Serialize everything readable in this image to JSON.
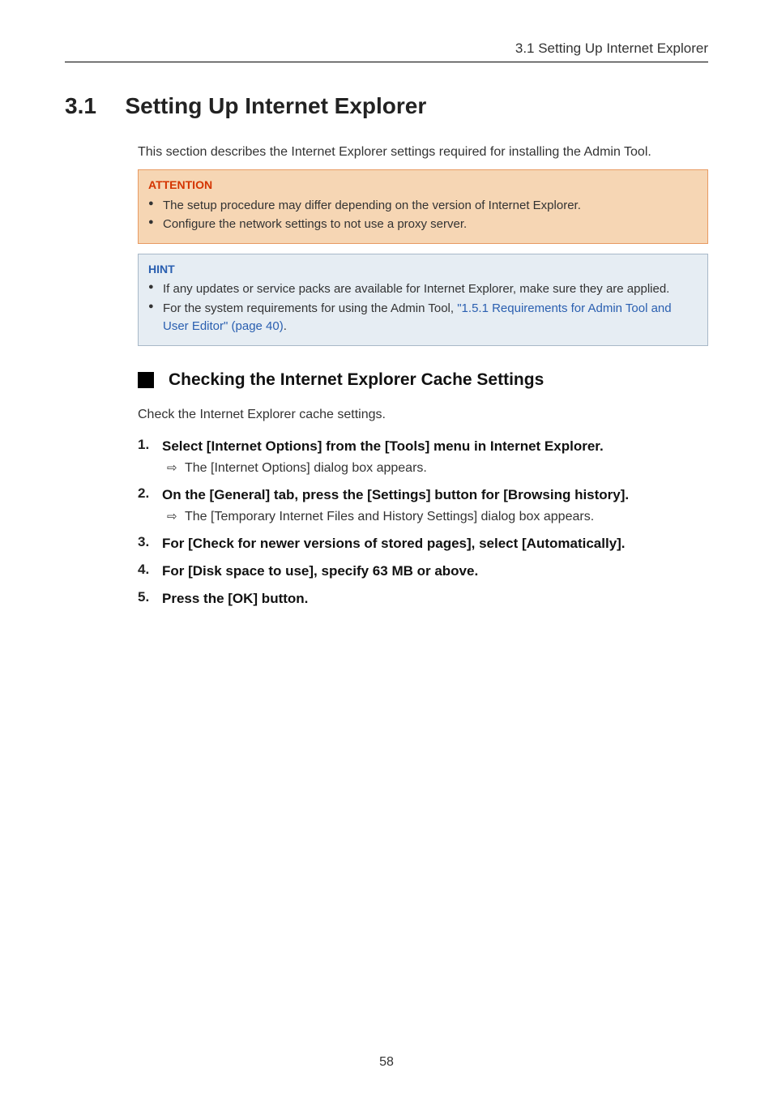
{
  "header": {
    "breadcrumb": "3.1 Setting Up Internet Explorer"
  },
  "section": {
    "number": "3.1",
    "title": "Setting Up Internet Explorer"
  },
  "intro": "This section describes the Internet Explorer settings required for installing the Admin Tool.",
  "attention": {
    "title": "ATTENTION",
    "items": [
      "The setup procedure may differ depending on the version of Internet Explorer.",
      "Configure the network settings to not use a proxy server."
    ]
  },
  "hint": {
    "title": "HINT",
    "item1": "If any updates or service packs are available for Internet Explorer, make sure they are applied.",
    "item2_prefix": "For the system requirements for using the Admin Tool, ",
    "item2_link": "\"1.5.1 Requirements for Admin Tool and User Editor\" (page 40)",
    "item2_suffix": "."
  },
  "subsection": {
    "title": "Checking the Internet Explorer Cache Settings",
    "intro": "Check the Internet Explorer cache settings."
  },
  "steps": [
    {
      "title": "Select [Internet Options] from the [Tools] menu in Internet Explorer.",
      "result": "The [Internet Options] dialog box appears."
    },
    {
      "title": "On the [General] tab, press the [Settings] button for [Browsing history].",
      "result": "The [Temporary Internet Files and History Settings] dialog box appears."
    },
    {
      "title": "For [Check for newer versions of stored pages], select [Automatically]."
    },
    {
      "title": "For [Disk space to use], specify 63 MB or above."
    },
    {
      "title": "Press the [OK] button."
    }
  ],
  "pageNumber": "58"
}
